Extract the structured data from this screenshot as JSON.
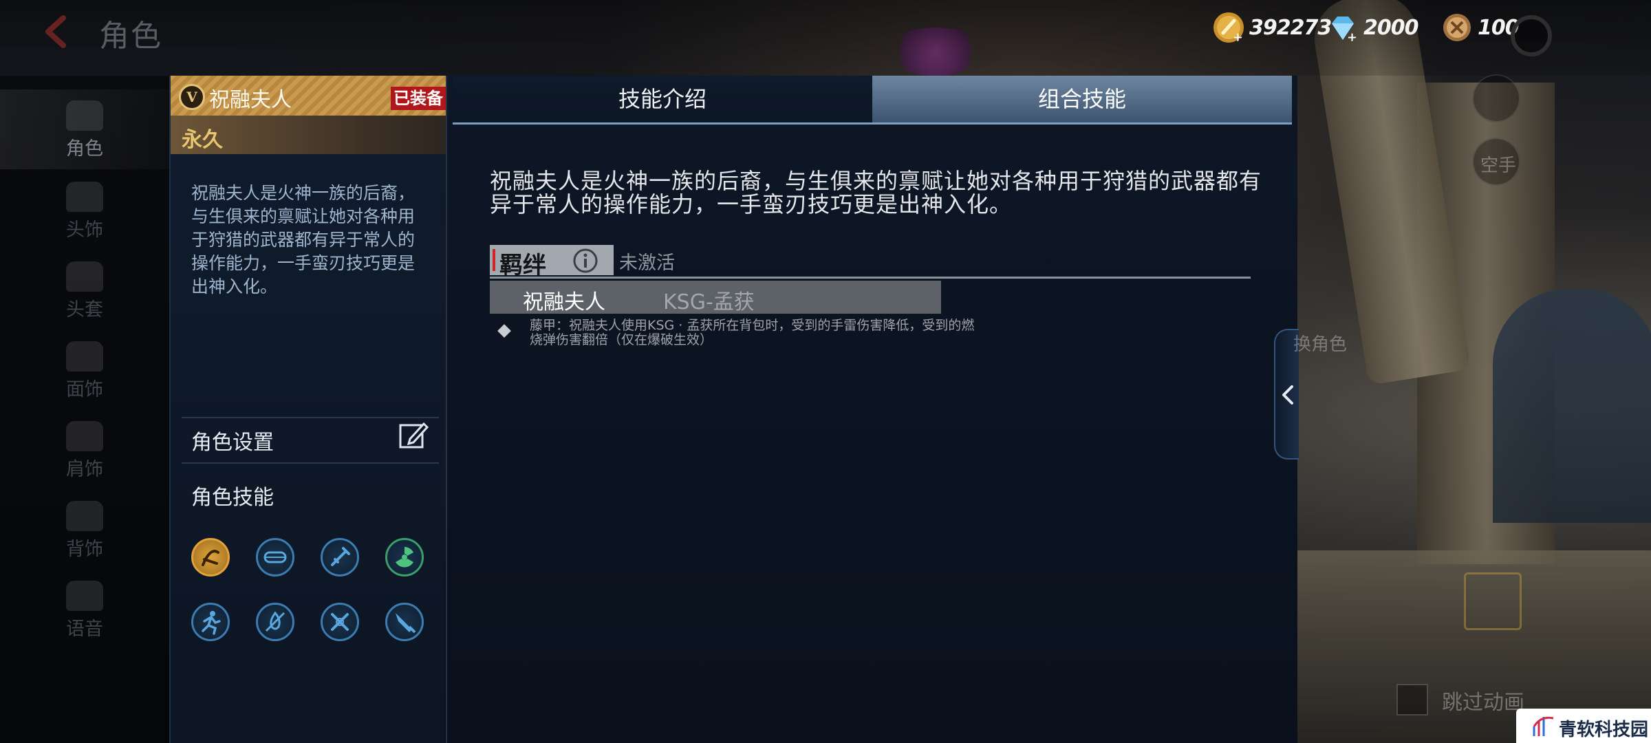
{
  "header": {
    "title": "角色",
    "currencies": [
      {
        "name": "gold",
        "value": "392273",
        "color": "#d8a844"
      },
      {
        "name": "diamond",
        "value": "2000",
        "color": "#8ad4ff"
      },
      {
        "name": "coin",
        "value": "100",
        "color": "#caa070"
      }
    ]
  },
  "sidebar": {
    "items": [
      {
        "label": "角色"
      },
      {
        "label": "头饰"
      },
      {
        "label": "头套"
      },
      {
        "label": "面饰"
      },
      {
        "label": "肩饰"
      },
      {
        "label": "背饰"
      },
      {
        "label": "语音"
      }
    ]
  },
  "character": {
    "name": "祝融夫人",
    "equipped": "已装备",
    "duration": "永久",
    "description": "祝融夫人是火神一族的后裔，与生俱来的禀赋让她对各种用于狩猎的武器都有异于常人的操作能力，一手蛮刃技巧更是出神入化。",
    "settings_label": "角色设置",
    "skills_label": "角色技能"
  },
  "tabs": {
    "intro": "技能介绍",
    "combo": "组合技能"
  },
  "combo": {
    "description": "祝融夫人是火神一族的后裔，与生俱来的禀赋让她对各种用于狩猎的武器都有异于常人的操作能力，一手蛮刃技巧更是出神入化。",
    "bond_label": "羁绊",
    "bond_status": "未激活",
    "pair_character": "祝融夫人",
    "pair_weapon": "KSG-孟获",
    "bonus_text": "藤甲：祝融夫人使用KSG · 孟获所在背包时，受到的手雷伤害降低，受到的燃烧弹伤害翻倍（仅在爆破生效）"
  },
  "right_controls": {
    "hand_label": "空手",
    "change_label": "换角色",
    "skip_label": "跳过动画"
  },
  "watermark": {
    "text": "青软科技园"
  }
}
